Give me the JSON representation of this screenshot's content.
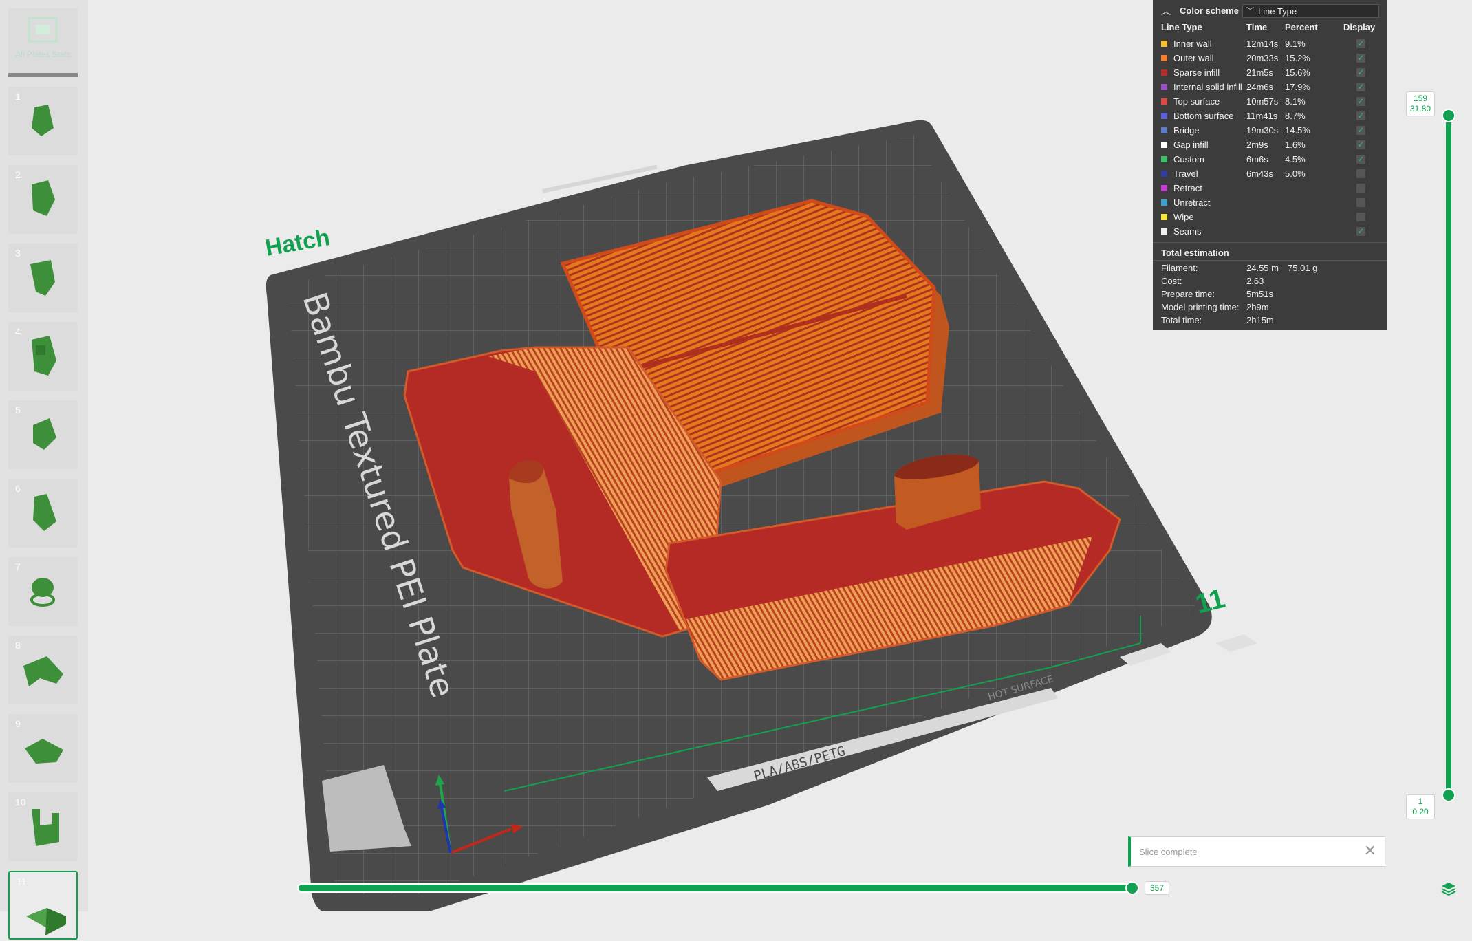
{
  "sidebar": {
    "all_plates_label": "All Plates Stats",
    "plates": [
      {
        "number": "1"
      },
      {
        "number": "2"
      },
      {
        "number": "3"
      },
      {
        "number": "4"
      },
      {
        "number": "5"
      },
      {
        "number": "6"
      },
      {
        "number": "7"
      },
      {
        "number": "8"
      },
      {
        "number": "9"
      },
      {
        "number": "10"
      },
      {
        "number": "11"
      }
    ],
    "selected_plate": "11"
  },
  "plate": {
    "model_name": "Hatch",
    "plate_number": "11",
    "plate_type_text": "Bambu Textured PEI Plate",
    "material_text": "PLA/ABS/PETG",
    "warning_text": "HOT SURFACE"
  },
  "legend": {
    "title": "Color scheme",
    "scheme_value": "Line Type",
    "columns": [
      "Line Type",
      "Time",
      "Percent",
      "Display"
    ],
    "rows": [
      {
        "name": "Inner wall",
        "time": "12m14s",
        "percent": "9.1%",
        "color": "#f7c02f",
        "checked": true
      },
      {
        "name": "Outer wall",
        "time": "20m33s",
        "percent": "15.2%",
        "color": "#f08033",
        "checked": true
      },
      {
        "name": "Sparse infill",
        "time": "21m5s",
        "percent": "15.6%",
        "color": "#b32d2d",
        "checked": true
      },
      {
        "name": "Internal solid infill",
        "time": "24m6s",
        "percent": "17.9%",
        "color": "#9b4fc4",
        "checked": true
      },
      {
        "name": "Top surface",
        "time": "10m57s",
        "percent": "8.1%",
        "color": "#e04848",
        "checked": true
      },
      {
        "name": "Bottom surface",
        "time": "11m41s",
        "percent": "8.7%",
        "color": "#5a60d6",
        "checked": true
      },
      {
        "name": "Bridge",
        "time": "19m30s",
        "percent": "14.5%",
        "color": "#5b7fc8",
        "checked": true
      },
      {
        "name": "Gap infill",
        "time": "2m9s",
        "percent": "1.6%",
        "color": "#ffffff",
        "checked": true
      },
      {
        "name": "Custom",
        "time": "6m6s",
        "percent": "4.5%",
        "color": "#3fbf6a",
        "checked": true
      },
      {
        "name": "Travel",
        "time": "6m43s",
        "percent": "5.0%",
        "color": "#2f3fa0",
        "checked": false
      },
      {
        "name": "Retract",
        "time": "",
        "percent": "",
        "color": "#c43fd0",
        "checked": false
      },
      {
        "name": "Unretract",
        "time": "",
        "percent": "",
        "color": "#3fa0d0",
        "checked": false
      },
      {
        "name": "Wipe",
        "time": "",
        "percent": "",
        "color": "#f5e63c",
        "checked": false
      },
      {
        "name": "Seams",
        "time": "",
        "percent": "",
        "color": "#f0f0f0",
        "checked": true
      }
    ],
    "total_label": "Total estimation",
    "estimation": [
      {
        "key": "Filament:",
        "value": "24.55 m",
        "value2": "75.01 g"
      },
      {
        "key": "Cost:",
        "value": "2.63",
        "value2": ""
      },
      {
        "key": "Prepare time:",
        "value": "5m51s",
        "value2": ""
      },
      {
        "key": "Model printing time:",
        "value": "2h9m",
        "value2": ""
      },
      {
        "key": "Total time:",
        "value": "2h15m",
        "value2": ""
      }
    ]
  },
  "layer_slider": {
    "top_layer": "159",
    "top_height": "31.80",
    "bottom_layer": "1",
    "bottom_height": "0.20"
  },
  "move_slider": {
    "value": "357"
  },
  "notification": {
    "text": "Slice complete"
  },
  "colors": {
    "accent": "#12a150",
    "plate": "#4a4a4a"
  }
}
